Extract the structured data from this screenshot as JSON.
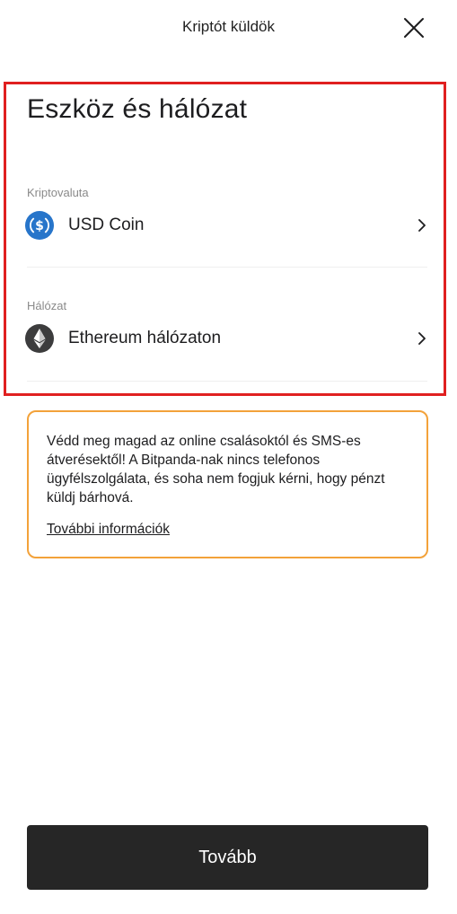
{
  "header": {
    "title": "Kriptót küldök"
  },
  "section": {
    "title": "Eszköz és hálózat"
  },
  "crypto_field": {
    "label": "Kriptovaluta",
    "value": "USD Coin",
    "icon": "usd-coin-icon",
    "icon_color": "#2775ca"
  },
  "network_field": {
    "label": "Hálózat",
    "value": "Ethereum hálózaton",
    "icon": "ethereum-icon",
    "icon_color": "#3c3c3d"
  },
  "warning": {
    "text": "Védd meg magad az online csalásoktól és SMS-es átverésektől! A Bitpanda-nak nincs telefonos ügyfélszolgálata, és soha nem fogjuk kérni, hogy pénzt küldj bárhová.",
    "link_label": "További információk",
    "border_color": "#f3a23a"
  },
  "footer": {
    "continue_label": "Tovább"
  },
  "colors": {
    "highlight": "#e02020",
    "button_bg": "#262626"
  }
}
